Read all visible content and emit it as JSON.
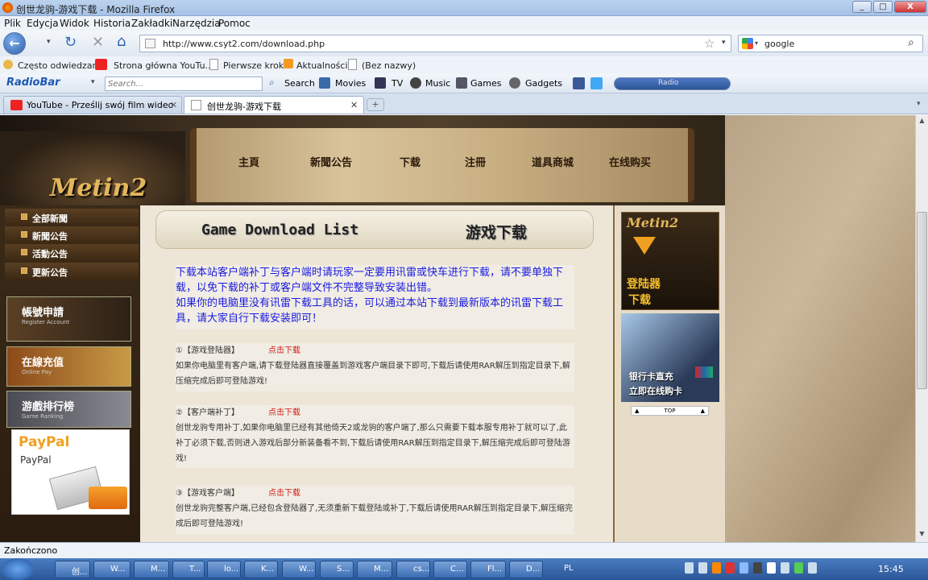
{
  "window": {
    "title": "创世龙驹-游戏下载 - Mozilla Firefox",
    "min": "_",
    "max": "□",
    "close": "X"
  },
  "menu": [
    "Plik",
    "Edycja",
    "Widok",
    "Historia",
    "Zakładki",
    "Narzędzia",
    "Pomoc"
  ],
  "address": {
    "url": "http://www.csyt2.com/download.php"
  },
  "search": {
    "value": "google"
  },
  "bookmarks": [
    "Często odwiedzane",
    "Strona główna YouTu...",
    "Pierwsze kroki",
    "Aktualności",
    "(Bez nazwy)"
  ],
  "radiobar": {
    "logo": "RadioBar",
    "search_placeholder": "Search...",
    "items": [
      "Search",
      "Movies",
      "TV",
      "Music",
      "Games",
      "Gadgets"
    ],
    "radio_label": "Radio"
  },
  "tabs": [
    {
      "title": "YouTube - Prześlij swój film wideo",
      "close": "✕"
    },
    {
      "title": "创世龙驹-游戏下载",
      "close": "✕"
    }
  ],
  "site": {
    "logo": "Metin2",
    "nav": [
      "主頁",
      "新聞公告",
      "下载",
      "注冊",
      "道具商城",
      "在线购买"
    ],
    "left_menu": [
      "全部新聞",
      "新聞公告",
      "活動公告",
      "更新公告"
    ],
    "promos": [
      {
        "title": "帳號申請",
        "sub": "Register Account"
      },
      {
        "title": "在線充值",
        "sub": "Online Pay"
      },
      {
        "title": "游戲排行榜",
        "sub": "Game Ranking"
      }
    ],
    "paypal": {
      "line1": "PayPal",
      "line2": "PayPal"
    },
    "header_en": "Game Download List",
    "header_cn": "游戏下载",
    "intro": "下载本站客户端补丁与客户端时请玩家一定要用讯雷或快车进行下载，请不要单独下载，以免下载的补丁或客户端文件不完整导致安装出错。\n如果你的电脑里没有讯雷下载工具的话，可以通过本站下载到最新版本的讯雷下载工具，请大家自行下载安装即可！",
    "items": [
      {
        "no": "①",
        "name": "【游戏登陆器】",
        "link": "点击下载",
        "desc": "如果你电脑里有客户端,请下载登陆器直接覆盖到游戏客户端目录下即可,下载后请使用RAR解压到指定目录下,解压缩完成后即可登陆游戏!"
      },
      {
        "no": "②",
        "name": "【客户端补丁】",
        "link": "点击下载",
        "desc": "创世龙驹专用补丁,如果你电脑里已经有其他倚天2或龙驹的客户端了,那么只需要下载本服专用补丁就可以了,此补丁必须下载,否则进入游戏后部分新装备看不到,下载后请使用RAR解压到指定目录下,解压缩完成后即可登陆游戏!"
      },
      {
        "no": "③",
        "name": "【游戏客户端】",
        "link": "点击下载",
        "desc": "创世龙驹完整客户端,已经包含登陆器了,无须重新下载登陆或补丁,下载后请使用RAR解压到指定目录下,解压缩完成后即可登陆游戏!"
      }
    ],
    "right_banner1": {
      "logo": "Metin2",
      "l1": "登陆器",
      "l2": "下载"
    },
    "right_banner2": {
      "l1": "银行卡直充",
      "l2": "立即在线购卡"
    },
    "top_label": "TOP"
  },
  "status": "Zakończono",
  "taskbar": {
    "items": [
      "创...",
      "W...",
      "M...",
      "T...",
      "lo...",
      "K...",
      "W...",
      "S...",
      "M...",
      "cs...",
      "C...",
      "Fl...",
      "D..."
    ],
    "lang": "PL",
    "clock": "15:45"
  }
}
